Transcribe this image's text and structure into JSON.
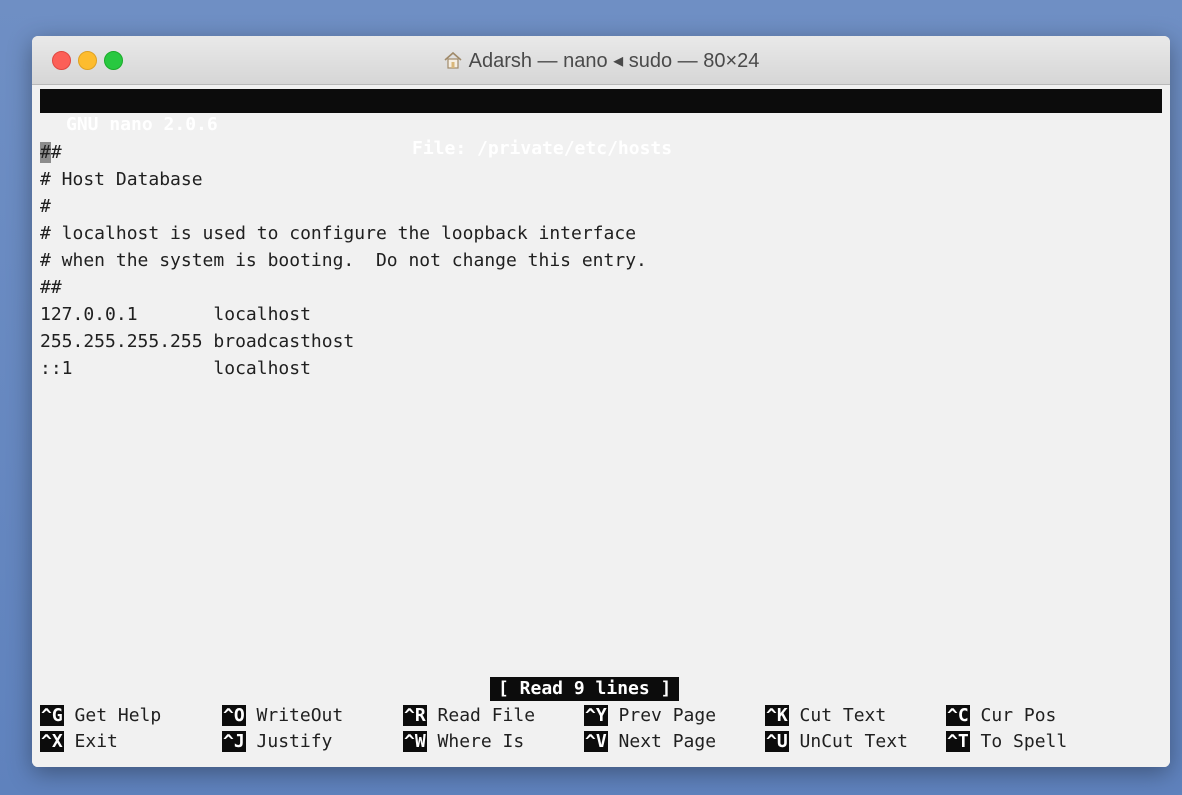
{
  "window": {
    "title": "Adarsh — nano ◂ sudo — 80×24"
  },
  "nano": {
    "version": "GNU nano 2.0.6",
    "file": "File: /private/etc/hosts",
    "cursor_char": "#",
    "lines": [
      "#",
      "# Host Database",
      "#",
      "# localhost is used to configure the loopback interface",
      "# when the system is booting.  Do not change this entry.",
      "##",
      "127.0.0.1       localhost",
      "255.255.255.255 broadcasthost",
      "::1             localhost"
    ],
    "status": "[ Read 9 lines ]",
    "shortcuts": [
      {
        "key": "^G",
        "label": "Get Help"
      },
      {
        "key": "^O",
        "label": "WriteOut"
      },
      {
        "key": "^R",
        "label": "Read File"
      },
      {
        "key": "^Y",
        "label": "Prev Page"
      },
      {
        "key": "^K",
        "label": "Cut Text"
      },
      {
        "key": "^C",
        "label": "Cur Pos"
      },
      {
        "key": "^X",
        "label": "Exit"
      },
      {
        "key": "^J",
        "label": "Justify"
      },
      {
        "key": "^W",
        "label": "Where Is"
      },
      {
        "key": "^V",
        "label": "Next Page"
      },
      {
        "key": "^U",
        "label": "UnCut Text"
      },
      {
        "key": "^T",
        "label": "To Spell"
      }
    ]
  }
}
